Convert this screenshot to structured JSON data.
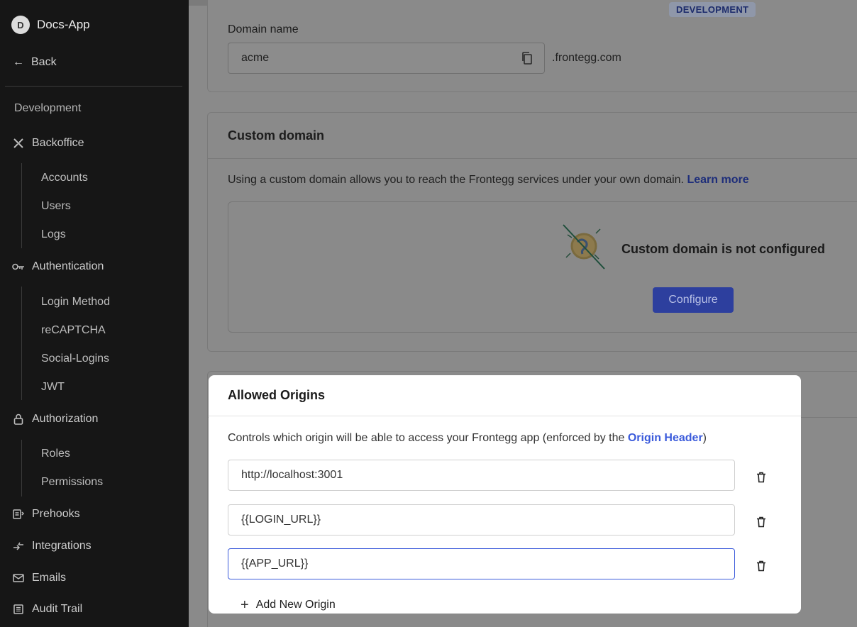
{
  "app": {
    "avatar_letter": "D",
    "name": "Docs-App"
  },
  "sidebar": {
    "back_label": "Back",
    "section_label": "Development",
    "groups": {
      "backoffice": {
        "label": "Backoffice",
        "items": [
          "Accounts",
          "Users",
          "Logs"
        ]
      },
      "authentication": {
        "label": "Authentication",
        "items": [
          "Login Method",
          "reCAPTCHA",
          "Social-Logins",
          "JWT"
        ]
      },
      "authorization": {
        "label": "Authorization",
        "items": [
          "Roles",
          "Permissions"
        ]
      },
      "prehooks": {
        "label": "Prehooks"
      },
      "integrations": {
        "label": "Integrations"
      },
      "emails": {
        "label": "Emails"
      },
      "audit_trail": {
        "label": "Audit Trail"
      }
    }
  },
  "domain_card": {
    "env_badge": "DEVELOPMENT",
    "label": "Domain name",
    "value": "acme",
    "suffix": ".frontegg.com"
  },
  "custom_domain_card": {
    "title": "Custom domain",
    "description": "Using a custom domain allows you to reach the Frontegg services under your own domain.",
    "learn_more": "Learn more",
    "empty_state": "Custom domain is not configured",
    "configure_label": "Configure"
  },
  "modal": {
    "title": "Allowed Origins",
    "description": "Controls which origin will be able to access your Frontegg app (enforced by the ",
    "description_link": "Origin Header",
    "description_end": ")",
    "origins": [
      "http://localhost:3001",
      "{{LOGIN_URL}}",
      "{{APP_URL}}"
    ],
    "add_label": "Add New Origin"
  },
  "colors": {
    "sidebar_bg": "#161616",
    "overlay_bg": "#8a8a8a",
    "accent": "#3b5bdb",
    "button_dim": "#2d3f9e"
  }
}
